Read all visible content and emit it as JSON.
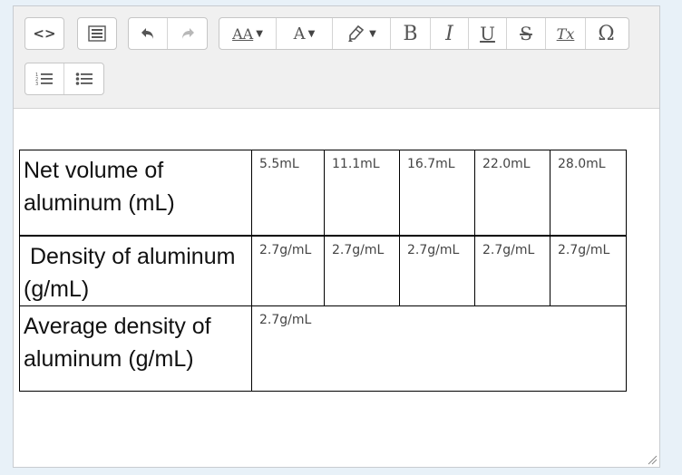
{
  "toolbar": {
    "source_label": "<>",
    "font_size_label": "AA",
    "font_color_label": "A",
    "bold_label": "B",
    "italic_label": "I",
    "underline_label": "U",
    "strike_label": "S",
    "clear_format_label": "Tx",
    "special_char_label": "Ω",
    "disabled_color": "#b8b8b8"
  },
  "table": {
    "rows": [
      {
        "header": "Net volume of aluminum (mL)",
        "cells": [
          "5.5mL",
          "11.1mL",
          "16.7mL",
          "22.0mL",
          "28.0mL"
        ]
      },
      {
        "header": " Density of aluminum (g/mL)",
        "cells": [
          "2.7g/mL",
          "2.7g/mL",
          "2.7g/mL",
          "2.7g/mL",
          "2.7g/mL"
        ]
      },
      {
        "header": "Average density of aluminum (g/mL)",
        "cells": [
          "2.7g/mL"
        ]
      }
    ]
  }
}
